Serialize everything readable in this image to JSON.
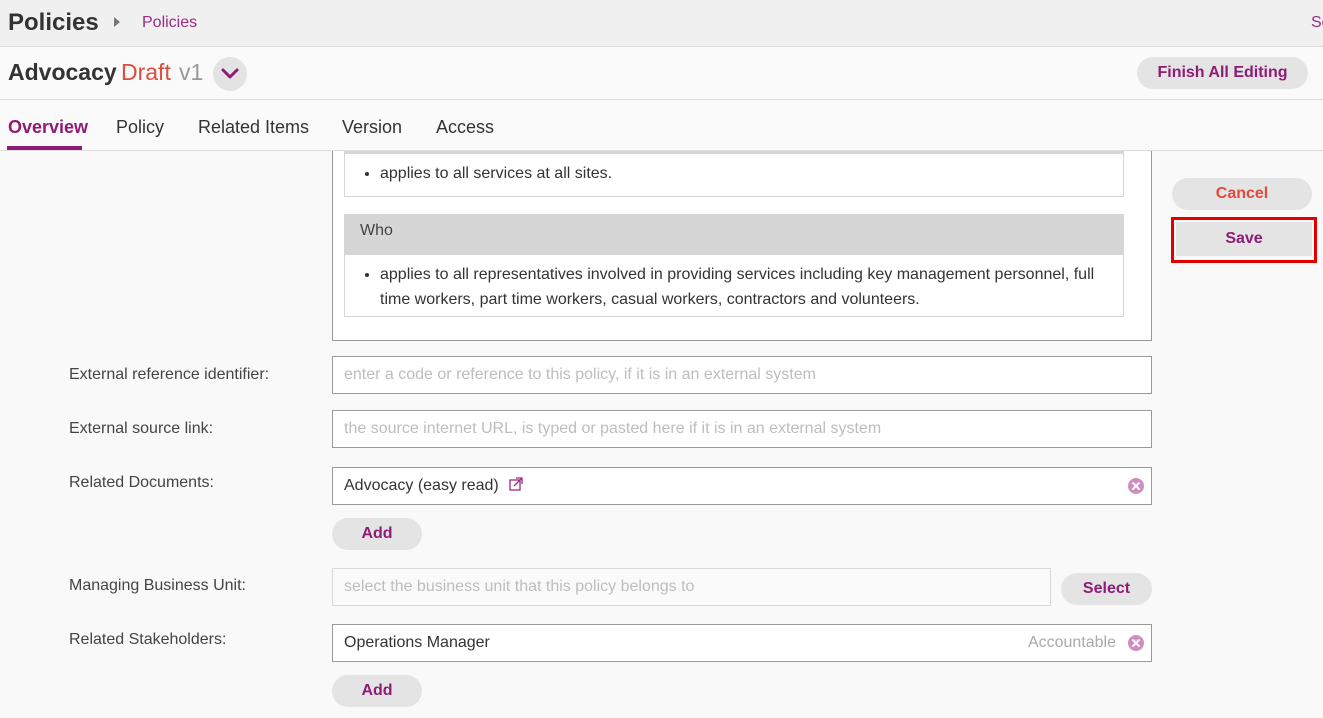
{
  "topbar": {
    "app_title": "Policies",
    "breadcrumb": "Policies",
    "cut_text": "Se"
  },
  "titlebar": {
    "title": "Advocacy",
    "status": "Draft",
    "version": "v1",
    "finish_label": "Finish All Editing"
  },
  "tabs": [
    {
      "label": "Overview",
      "active": true
    },
    {
      "label": "Policy"
    },
    {
      "label": "Related Items"
    },
    {
      "label": "Version"
    },
    {
      "label": "Access"
    }
  ],
  "scope": {
    "first_item": "applies to all services at all sites.",
    "who_heading": "Who",
    "who_item": "applies to all representatives involved in providing services including key management personnel, full time workers, part time workers, casual workers, contractors and volunteers."
  },
  "form": {
    "ext_ref": {
      "label": "External reference identifier:",
      "placeholder": "enter a code or reference to this policy, if it is in an external system"
    },
    "ext_link": {
      "label": "External source link:",
      "placeholder": "the source internet URL, is typed or pasted here if it is in an external system"
    },
    "related_docs": {
      "label": "Related Documents:",
      "value": "Advocacy (easy read)",
      "add_label": "Add"
    },
    "business_unit": {
      "label": "Managing Business Unit:",
      "placeholder": "select the business unit that this policy belongs to",
      "select_label": "Select"
    },
    "stakeholders": {
      "label": "Related Stakeholders:",
      "value": "Operations Manager",
      "role": "Accountable",
      "add_label": "Add"
    }
  },
  "actions": {
    "cancel_label": "Cancel",
    "save_label": "Save"
  },
  "colors": {
    "accent": "#8e1b76",
    "danger": "#e24a3b",
    "highlight": "#e00000"
  }
}
